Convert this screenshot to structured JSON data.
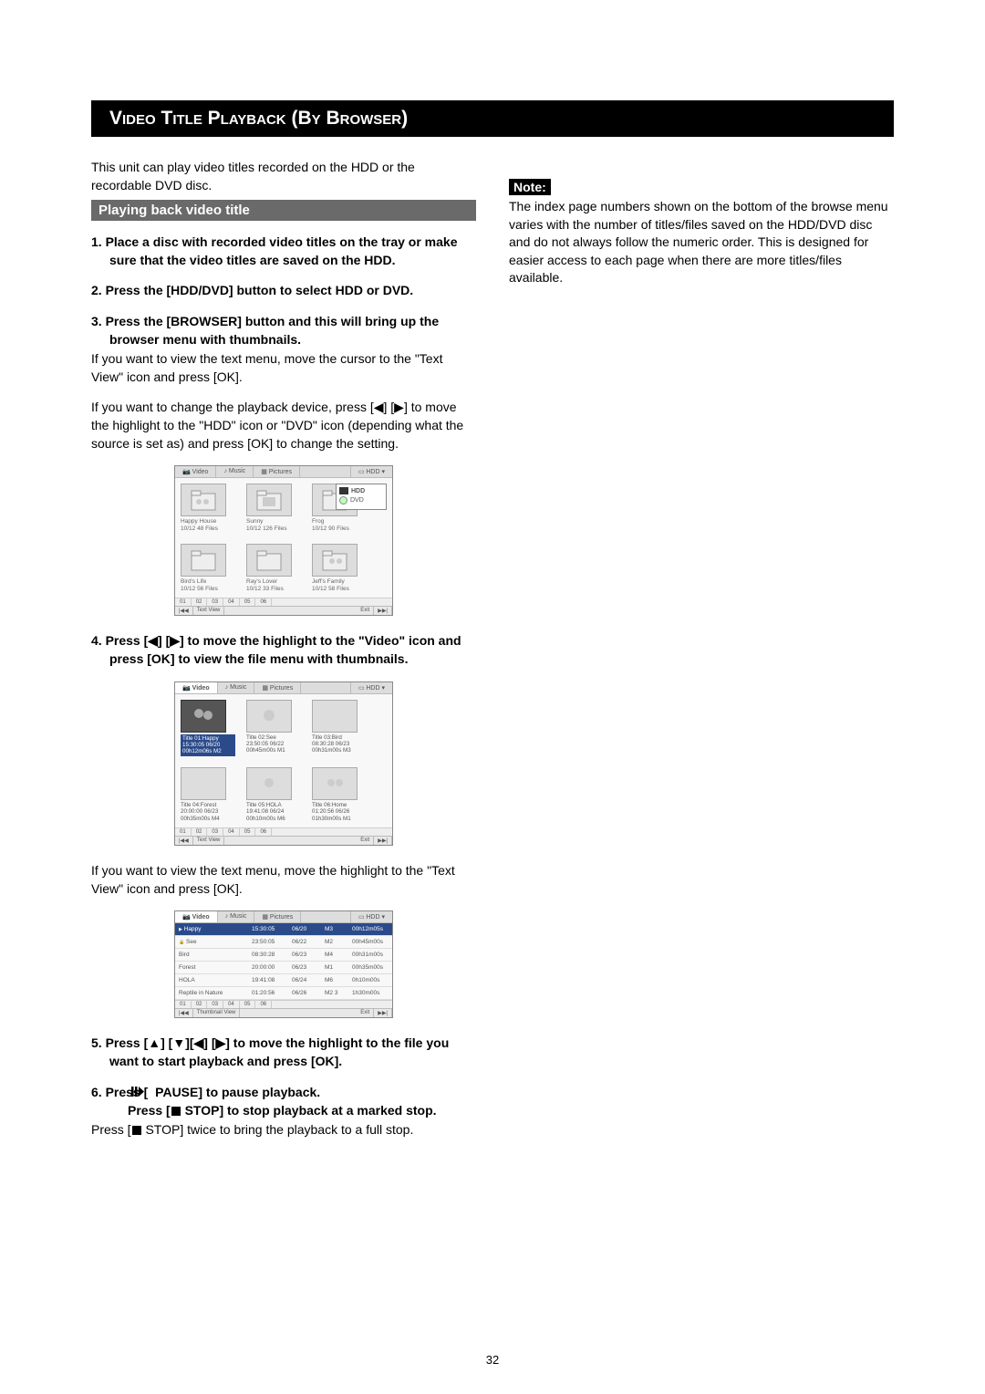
{
  "section": {
    "title": "Video Title Playback (By Browser)"
  },
  "left": {
    "intro": "This unit can play video titles recorded on the HDD or the recordable DVD disc.",
    "subheader": "Playing back video title",
    "step1": "1. Place a disc with recorded video titles on the tray or make sure that the video titles are saved on the HDD.",
    "step2": "2. Press the [HDD/DVD] button to select HDD or DVD.",
    "step3": "3. Press the [BROWSER] button and this will bring up the browser menu with thumbnails.",
    "step3_body_a": "If you want to view the text menu, move the cursor to the \"Text View\" icon and press [OK].",
    "step3_body_b": "If you want to change the playback device, press [◀] [▶] to move the highlight to the \"HDD\" icon or \"DVD\" icon (depending what the source is set as) and press [OK] to change the setting.",
    "step4": "4. Press [◀] [▶] to move the highlight to the \"Video\" icon and press [OK] to view the file menu with thumbnails.",
    "step4_body": "If you want to view the text menu, move the highlight to the \"Text View\" icon and press [OK].",
    "step5": "5. Press [▲] [▼][◀] [▶] to move the highlight to the file you want to start playback and press [OK].",
    "step6a": "6. Press [",
    "step6b": " PAUSE] to pause playback.",
    "step6c": "Press [",
    "step6d": " STOP] to stop playback at a marked stop.",
    "step6_body_a": "Press [",
    "step6_body_b": " STOP] twice to bring the playback to a full stop."
  },
  "right": {
    "note_label": "Note:",
    "note_body": "The index page numbers shown on the bottom of the browse menu varies with the number of titles/files saved on the HDD/DVD disc and do not always follow the numeric order.  This is designed for easier access to each page when there are more titles/files available."
  },
  "ui_shot1": {
    "tabs": {
      "video": "Video",
      "music": "Music",
      "pictures": "Pictures",
      "device": "HDD ▾"
    },
    "device_popup": {
      "hdd": "HDD",
      "dvd": "DVD"
    },
    "items": [
      {
        "name": "Happy House",
        "sub": "10/12 48 Files"
      },
      {
        "name": "Sunny",
        "sub": "10/12 126 Files"
      },
      {
        "name": "Frog",
        "sub": "10/12 90 Files"
      },
      {
        "name": "Bird's Life",
        "sub": "10/12 56 Files"
      },
      {
        "name": "Ray's Lover",
        "sub": "10/12 33 Files"
      },
      {
        "name": "Jeff's Family",
        "sub": "10/12 58 Files"
      }
    ],
    "pages": [
      "01",
      "02",
      "03",
      "04",
      "05",
      "06"
    ],
    "footer": {
      "skip_prev": "|◀◀",
      "text_view": "Text View",
      "exit": "Exit",
      "skip_next": "▶▶|"
    }
  },
  "ui_shot2": {
    "tabs": {
      "video": "Video",
      "music": "Music",
      "pictures": "Pictures",
      "device": "HDD ▾"
    },
    "items": [
      {
        "l1": "Title 01:Happy",
        "l2": "15:30:05 06/20",
        "l3": "00h12m06s M2"
      },
      {
        "l1": "Title 02:See",
        "l2": "23:50:05 06/22",
        "l3": "00h45m00s M1"
      },
      {
        "l1": "Title 03:Bird",
        "l2": "08:30:28 06/23",
        "l3": "00h31m00s M3"
      },
      {
        "l1": "Title 04:Forest",
        "l2": "20:00:00 06/23",
        "l3": "00h35m00s M4"
      },
      {
        "l1": "Title 05:HOLA",
        "l2": "19:41:08 06/24",
        "l3": "00h10m00s M6"
      },
      {
        "l1": "Title 06:Home",
        "l2": "01:20:56 06/26",
        "l3": "01h30m00s M1"
      }
    ],
    "pages": [
      "01",
      "02",
      "03",
      "04",
      "05",
      "06"
    ],
    "footer": {
      "skip_prev": "|◀◀",
      "text_view": "Text View",
      "exit": "Exit",
      "skip_next": "▶▶|"
    }
  },
  "ui_shot3": {
    "tabs": {
      "video": "Video",
      "music": "Music",
      "pictures": "Pictures",
      "device": "HDD ▾"
    },
    "rows": [
      {
        "name": "Happy",
        "t1": "15:30:05",
        "t2": "06/20",
        "t3": "M3",
        "t4": "00h12m05s"
      },
      {
        "name": "See",
        "t1": "23:50:05",
        "t2": "06/22",
        "t3": "M2",
        "t4": "00h45m00s"
      },
      {
        "name": "Bird",
        "t1": "08:30:28",
        "t2": "06/23",
        "t3": "M4",
        "t4": "00h31m00s"
      },
      {
        "name": "Forest",
        "t1": "20:00:00",
        "t2": "06/23",
        "t3": "M1",
        "t4": "00h35m00s"
      },
      {
        "name": "HOLA",
        "t1": "19:41:08",
        "t2": "06/24",
        "t3": "M6",
        "t4": "0h10m00s"
      },
      {
        "name": "Reptile in Nature",
        "t1": "01:20:56",
        "t2": "06/26",
        "t3": "M2 3",
        "t4": "1h30m00s"
      }
    ],
    "pages": [
      "01",
      "02",
      "03",
      "04",
      "05",
      "06"
    ],
    "footer": {
      "skip_prev": "|◀◀",
      "thumb_view": "Thumbnail View",
      "exit": "Exit",
      "skip_next": "▶▶|"
    }
  },
  "page_number": "32"
}
